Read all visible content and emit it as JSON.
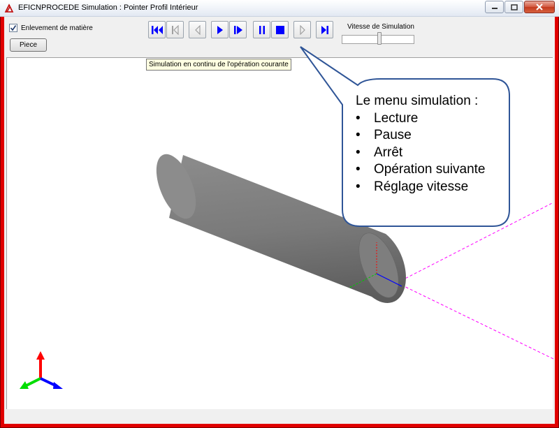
{
  "window": {
    "title": "EFICNPROCEDE Simulation : Pointer Profil Intérieur",
    "frame_color": "#e00000"
  },
  "toolbar": {
    "material_removal": {
      "label": "Enlevement de matière",
      "checked": true
    },
    "piece_button": "Piece",
    "sim_buttons": [
      {
        "name": "first-icon"
      },
      {
        "name": "step-back-icon"
      },
      {
        "name": "previous-icon"
      },
      {
        "name": "play-icon"
      },
      {
        "name": "play-step-icon"
      },
      {
        "name": "pause-icon"
      },
      {
        "name": "stop-icon"
      },
      {
        "name": "next-icon"
      },
      {
        "name": "last-icon"
      }
    ],
    "speed_label": "Vitesse de Simulation"
  },
  "tooltip": "Simulation en continu de l'opération courante",
  "callout": {
    "title": "Le menu simulation :",
    "items": [
      "Lecture",
      "Pause",
      "Arrêt",
      "Opération suivante",
      "Réglage vitesse"
    ],
    "border_color": "#2f5597"
  },
  "colors": {
    "accent_blue": "#0000ff",
    "disabled_icon": "#a0a0a0",
    "path_magenta": "#ff00ff",
    "cylinder_gray": "#7a7a7a"
  }
}
